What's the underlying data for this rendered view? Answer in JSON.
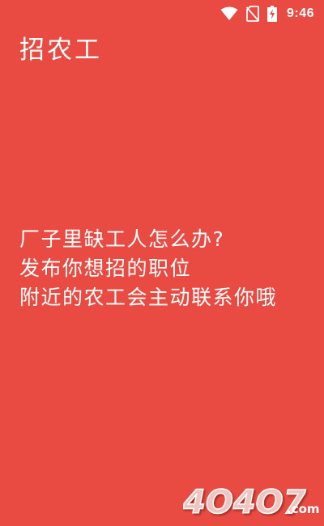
{
  "status_bar": {
    "time": "9:46",
    "icons": [
      "wifi-icon",
      "no-sim-icon",
      "battery-charging-icon"
    ]
  },
  "app": {
    "title": "招农工"
  },
  "message": {
    "lines": [
      "厂子里缺工人怎么办?",
      "发布你想招的职位",
      "附近的农工会主动联系你哦"
    ]
  },
  "watermark": {
    "brand": "4O4O7",
    "domain": ".com"
  },
  "colors": {
    "background": "#e94b43",
    "text": "#ffffff"
  }
}
